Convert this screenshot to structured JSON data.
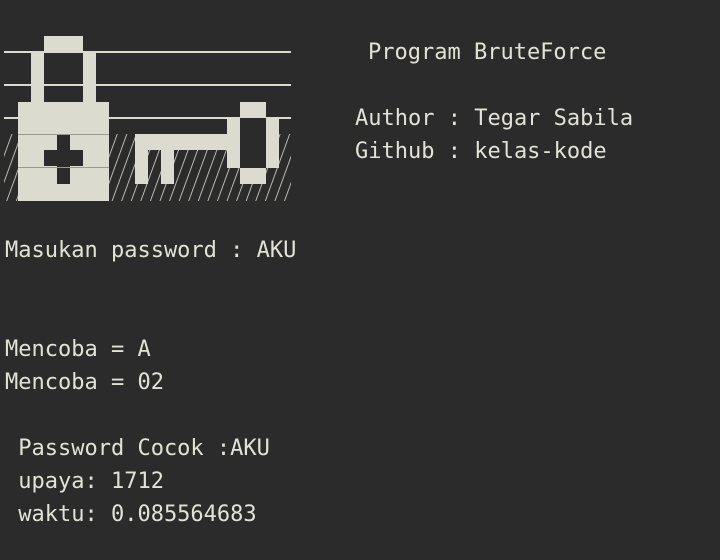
{
  "header": {
    "title": "Program BruteForce",
    "author_line": "Author : Tegar Sabila",
    "github_line": "Github : kelas-kode"
  },
  "banner": {
    "icon": "padlock-and-key-ascii-art",
    "fg_color": "#dcdbd0",
    "bg_color": "#2b2b2b"
  },
  "session": {
    "prompt_line": "Masukan password : AKU",
    "attempts": [
      "Mencoba = A",
      "Mencoba = 02"
    ]
  },
  "result": {
    "match_line": " Password Cocok :AKU",
    "attempts_line": " upaya: 1712",
    "time_line": " waktu: 0.085564683"
  },
  "colors": {
    "background": "#2b2b2b",
    "text": "#e2e2d7"
  }
}
